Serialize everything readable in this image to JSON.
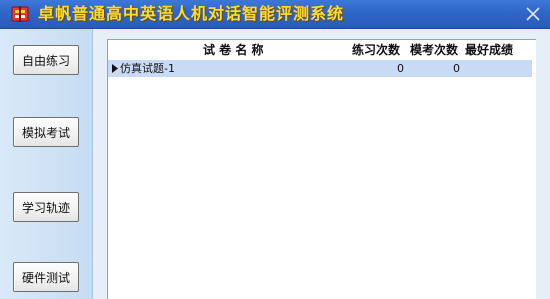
{
  "window": {
    "title": "卓帆普通高中英语人机对话智能评测系统"
  },
  "sidebar": {
    "buttons": [
      {
        "label": "自由练习"
      },
      {
        "label": "模拟考试"
      },
      {
        "label": "学习轨迹"
      },
      {
        "label": "硬件测试"
      }
    ]
  },
  "table": {
    "columns": [
      "试 卷 名 称",
      "练习次数",
      "模考次数",
      "最好成绩"
    ],
    "rows": [
      {
        "name": "仿真试题-1",
        "practice_count": "0",
        "mock_count": "0",
        "best_score": ""
      }
    ]
  },
  "colors": {
    "titlebar": "#2f66c8",
    "title_text": "#ffdc2e",
    "selected_row": "#c9daf4"
  },
  "icons": {
    "app": "app-logo-icon",
    "close": "close-icon",
    "row_pointer": "row-pointer-icon"
  }
}
